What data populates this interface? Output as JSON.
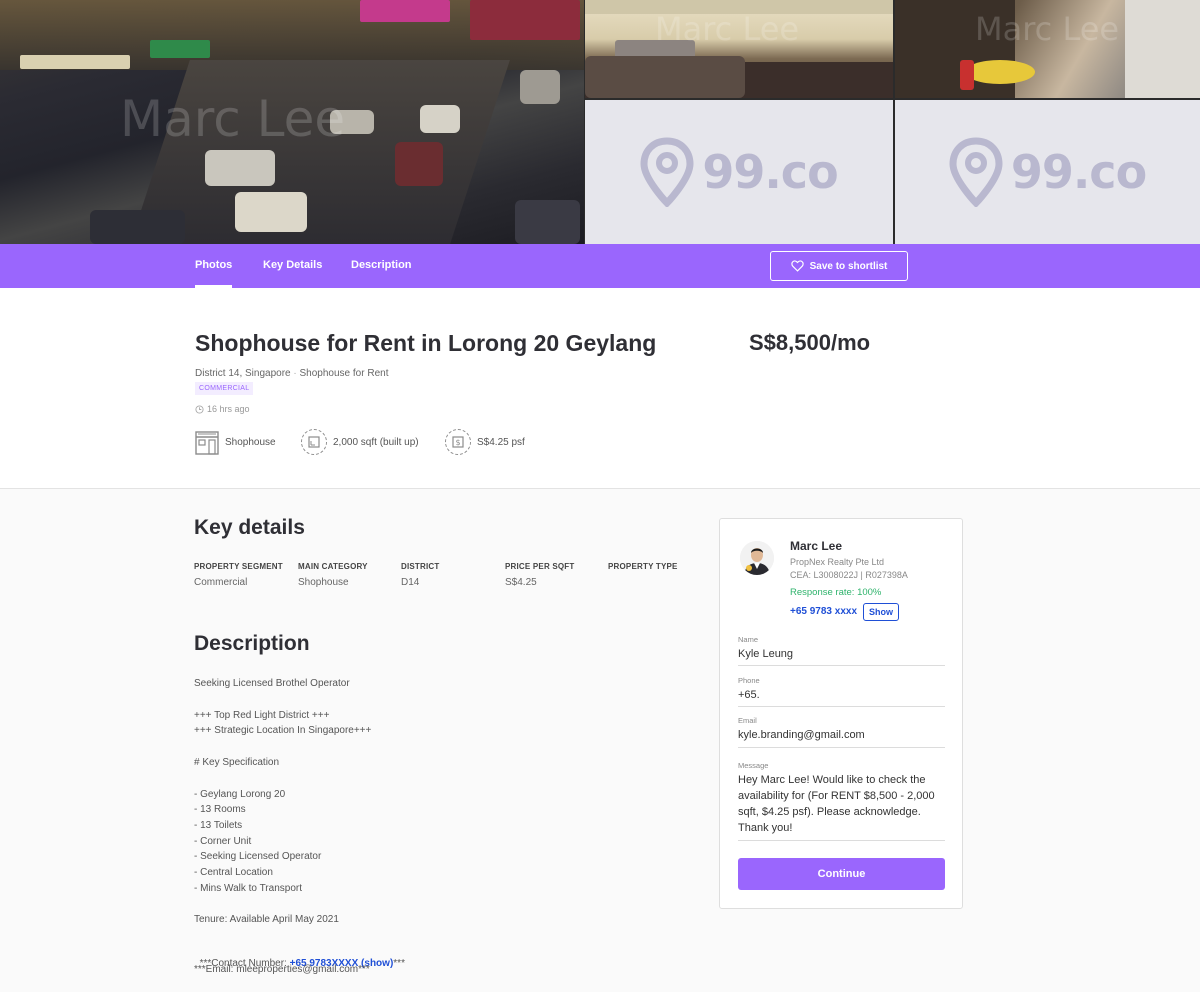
{
  "gallery": {
    "watermark_main": "Marc Lee",
    "watermark_tr1": "Marc Lee",
    "watermark_tr2": "Marc Lee",
    "placeholder_logo": "99.co"
  },
  "tabs": [
    {
      "label": "Photos",
      "active": true
    },
    {
      "label": "Key Details",
      "active": false
    },
    {
      "label": "Description",
      "active": false
    }
  ],
  "shortlist_button": "Save to shortlist",
  "listing": {
    "title": "Shophouse for Rent in Lorong 20 Geylang",
    "price": "S$8,500/mo",
    "location": "District 14, Singapore",
    "separator": "·",
    "type_line": "Shophouse for Rent",
    "tag": "COMMERCIAL",
    "posted": "16 hrs ago",
    "features": [
      {
        "icon": "shophouse-icon",
        "label": "Shophouse"
      },
      {
        "icon": "area-icon",
        "label": "2,000 sqft (built up)"
      },
      {
        "icon": "dollar-icon",
        "label": "S$4.25 psf"
      }
    ]
  },
  "key_details": {
    "heading": "Key details",
    "columns": [
      {
        "label": "PROPERTY SEGMENT",
        "value": "Commercial"
      },
      {
        "label": "MAIN CATEGORY",
        "value": "Shophouse"
      },
      {
        "label": "DISTRICT",
        "value": "D14"
      },
      {
        "label": "PRICE PER SQFT",
        "value": "S$4.25"
      },
      {
        "label": "PROPERTY TYPE",
        "value": ""
      }
    ]
  },
  "description": {
    "heading": "Description",
    "lines": [
      "Seeking Licensed Brothel Operator",
      "",
      "+++ Top Red Light District +++",
      "+++ Strategic Location In Singapore+++",
      "",
      "# Key Specification",
      "",
      "- Geylang Lorong 20",
      "- 13 Rooms",
      "- 13 Toilets",
      "- Corner Unit",
      "- Seeking Licensed Operator",
      "- Central Location",
      "- Mins Walk to Transport",
      "",
      "Tenure: Available April May 2021"
    ],
    "contact_prefix": "***Contact Number: ",
    "contact_link": "+65 9783XXXX (show)",
    "contact_suffix": "***",
    "email_line": "***Email: mleeproperties@gmail.com***"
  },
  "agent": {
    "name": "Marc Lee",
    "agency": "PropNex Realty Pte Ltd",
    "cea": "CEA: L3008022J | R027398A",
    "response_rate": "Response rate: 100%",
    "phone": "+65 9783 xxxx",
    "show_label": "Show"
  },
  "form": {
    "name_label": "Name",
    "name_value": "Kyle Leung",
    "phone_label": "Phone",
    "phone_value": "+65.",
    "email_label": "Email",
    "email_value": "kyle.branding@gmail.com",
    "message_label": "Message",
    "message_value": "Hey Marc Lee! Would like to check the availability for  (For RENT $8,500 - 2,000 sqft, $4.25 psf). Please acknowledge. Thank you!",
    "continue_label": "Continue"
  },
  "colors": {
    "accent": "#9a66fd",
    "link": "#1f4fd6",
    "success": "#2fb36c"
  }
}
